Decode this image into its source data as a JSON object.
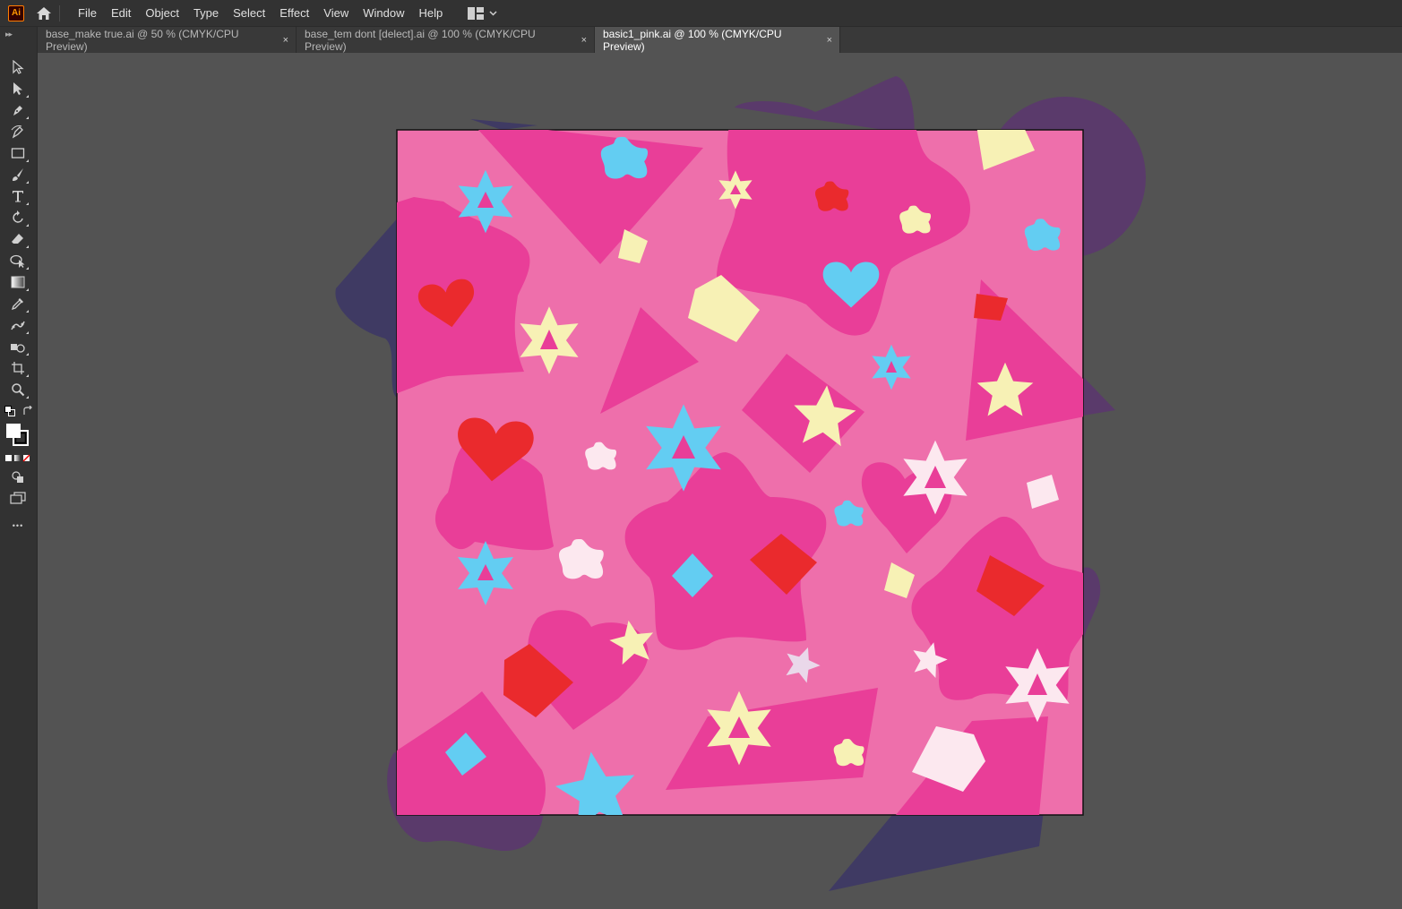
{
  "app": {
    "logo_text": "Ai",
    "menu": [
      "File",
      "Edit",
      "Object",
      "Type",
      "Select",
      "Effect",
      "View",
      "Window",
      "Help"
    ]
  },
  "tabs": [
    {
      "label": "base_make true.ai @ 50 % (CMYK/CPU Preview)",
      "close": "×",
      "active": false
    },
    {
      "label": "base_tem dont [delect].ai @ 100 % (CMYK/CPU Preview)",
      "close": "×",
      "active": false
    },
    {
      "label": "basic1_pink.ai @ 100 % (CMYK/CPU Preview)",
      "close": "×",
      "active": true
    }
  ],
  "toolbar": {
    "tools": [
      "selection-tool",
      "direct-selection-tool",
      "pen-tool",
      "curvature-tool",
      "rectangle-tool",
      "paintbrush-tool",
      "type-tool",
      "rotate-tool",
      "eraser-tool",
      "shape-builder-tool",
      "gradient-tool",
      "eyedropper-tool",
      "puppet-warp-tool",
      "symbol-sprayer-tool",
      "artboard-tool",
      "zoom-tool"
    ],
    "more_label": "•••"
  },
  "colors": {
    "artboard_pink": "#ee6fab",
    "magenta": "#e93e98",
    "purple": "#5a3a6b",
    "navy": "#3f3a63",
    "red": "#ea2a2d",
    "cyan": "#63cdf2",
    "cream": "#f7f1b5",
    "blush": "#fce8ef"
  }
}
